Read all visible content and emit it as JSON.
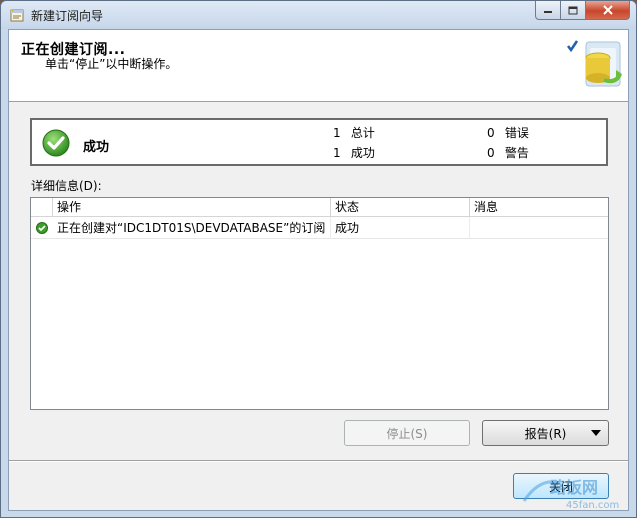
{
  "window": {
    "title": "新建订阅向导",
    "controls": {
      "minimize": "0",
      "maximize": "1",
      "close": "r"
    }
  },
  "header": {
    "title": "正在创建订阅...",
    "subtitle": "单击“停止”以中断操作。"
  },
  "summary": {
    "status": "成功",
    "stats": [
      {
        "count": "1",
        "label": "总计"
      },
      {
        "count": "0",
        "label": "错误"
      },
      {
        "count": "1",
        "label": "成功"
      },
      {
        "count": "0",
        "label": "警告"
      }
    ]
  },
  "details": {
    "label": "详细信息(D):",
    "columns": [
      "操作",
      "状态",
      "消息"
    ],
    "rows": [
      {
        "action": "正在创建对“IDC1DT01S\\DEVDATABASE”的订阅",
        "status": "成功",
        "message": ""
      }
    ]
  },
  "buttons": {
    "stop": "停止(S)",
    "report": "报告(R)",
    "close": "关闭"
  },
  "watermark": {
    "text": "路饭网",
    "url": "45fan.com"
  },
  "colors": {
    "success_green": "#3e9e2c",
    "title_bar": "#c6d6ea",
    "close_red": "#c8462d"
  }
}
